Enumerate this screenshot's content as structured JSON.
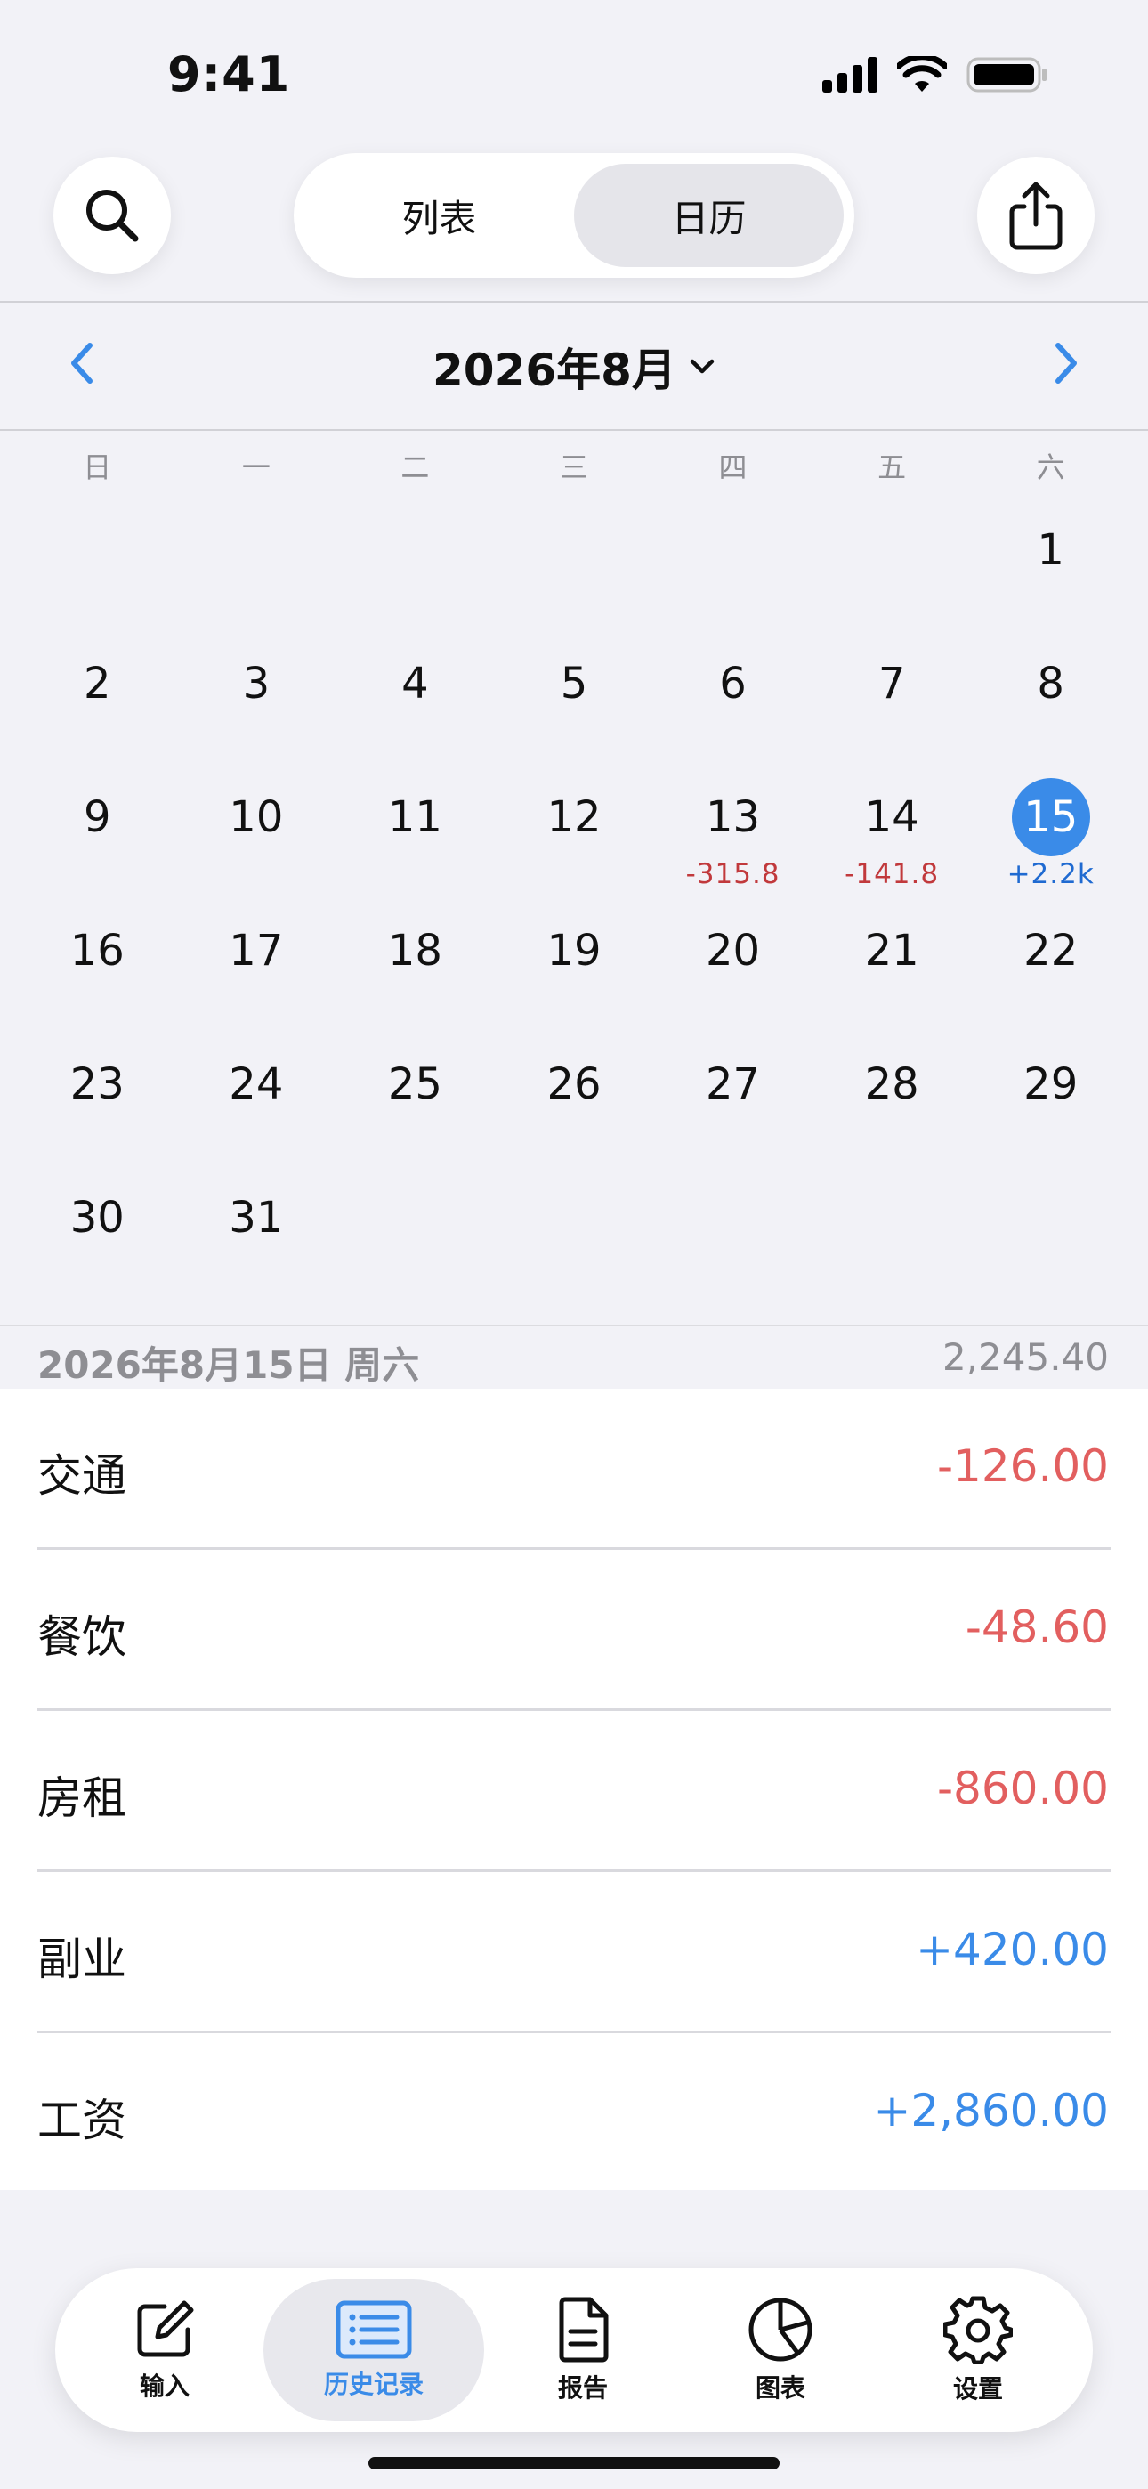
{
  "status_bar": {
    "time": "9:41"
  },
  "header": {
    "segments": [
      {
        "label": "列表"
      },
      {
        "label": "日历"
      }
    ],
    "active_segment": "日历"
  },
  "calendar": {
    "month_title": "2026年8月",
    "weekdays": [
      "日",
      "一",
      "二",
      "三",
      "四",
      "五",
      "六"
    ],
    "weeks": [
      [
        null,
        null,
        null,
        null,
        null,
        null,
        "1"
      ],
      [
        "2",
        "3",
        "4",
        "5",
        "6",
        "7",
        "8"
      ],
      [
        "9",
        "10",
        "11",
        "12",
        "13",
        "14",
        "15"
      ],
      [
        "16",
        "17",
        "18",
        "19",
        "20",
        "21",
        "22"
      ],
      [
        "23",
        "24",
        "25",
        "26",
        "27",
        "28",
        "29"
      ],
      [
        "30",
        "31",
        null,
        null,
        null,
        null,
        null
      ]
    ],
    "selected_day": "15",
    "day_totals": {
      "13": {
        "text": "-315.8",
        "sign": "neg"
      },
      "14": {
        "text": "-141.8",
        "sign": "neg"
      },
      "15": {
        "text": "+2.2k",
        "sign": "pos"
      }
    }
  },
  "detail": {
    "date": "2026年8月15日 周六",
    "total": "2,245.40",
    "entries": [
      {
        "name": "交通",
        "amount": "-126.00",
        "sign": "neg"
      },
      {
        "name": "餐饮",
        "amount": "-48.60",
        "sign": "neg"
      },
      {
        "name": "房租",
        "amount": "-860.00",
        "sign": "neg"
      },
      {
        "name": "副业",
        "amount": "+420.00",
        "sign": "pos"
      },
      {
        "name": "工资",
        "amount": "+2,860.00",
        "sign": "pos"
      }
    ]
  },
  "tab_bar": {
    "tabs": [
      {
        "label": "输入",
        "icon": "compose-icon"
      },
      {
        "label": "历史记录",
        "icon": "list-icon"
      },
      {
        "label": "报告",
        "icon": "document-icon"
      },
      {
        "label": "图表",
        "icon": "pie-chart-icon"
      },
      {
        "label": "设置",
        "icon": "gear-icon"
      }
    ],
    "active_tab": "历史记录"
  },
  "colors": {
    "accent": "#3a8be8",
    "negative": "#e25f5f",
    "positive": "#3a8be8",
    "background": "#f2f2f7"
  }
}
